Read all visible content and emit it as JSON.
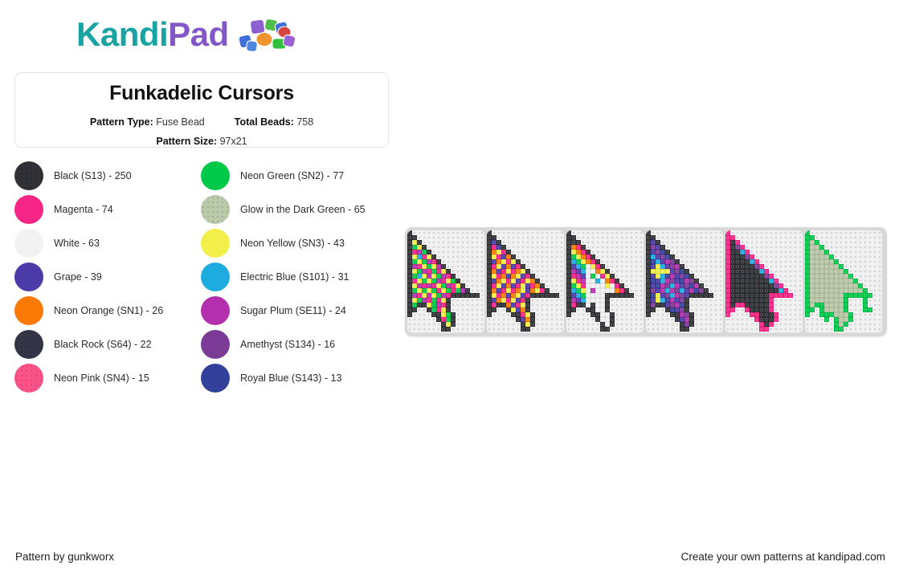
{
  "brand": {
    "name_part1": "Kandi",
    "name_part2": "Pad",
    "beads_icon": "kandi-beads-icon",
    "color_teal": "#1aa3a3",
    "color_purple": "#8457c9"
  },
  "title_card": {
    "title": "Funkadelic Cursors",
    "pattern_type_label": "Pattern Type:",
    "pattern_type_value": "Fuse Bead",
    "total_beads_label": "Total Beads:",
    "total_beads_value": "758",
    "pattern_size_label": "Pattern Size:",
    "pattern_size_value": "97x21"
  },
  "legend": {
    "items": [
      {
        "name": "Black (S13)",
        "count": "250",
        "label": "Black (S13) - 250",
        "color": "#2f3136",
        "dotted": true,
        "col": 0
      },
      {
        "name": "Neon Green (SN2)",
        "count": "77",
        "label": "Neon Green (SN2) - 77",
        "color": "#00c94a",
        "dotted": false,
        "col": 1
      },
      {
        "name": "Magenta",
        "count": "74",
        "label": "Magenta - 74",
        "color": "#f72585",
        "dotted": false,
        "col": 0
      },
      {
        "name": "Glow in the Dark Green",
        "count": "65",
        "label": "Glow in the Dark Green - 65",
        "color": "#b9c9a9",
        "dotted": true,
        "col": 1
      },
      {
        "name": "White",
        "count": "63",
        "label": "White - 63",
        "color": "#f2f2f2",
        "dotted": false,
        "col": 0
      },
      {
        "name": "Neon Yellow (SN3)",
        "count": "43",
        "label": "Neon Yellow (SN3) - 43",
        "color": "#f2ef4a",
        "dotted": false,
        "col": 1
      },
      {
        "name": "Grape",
        "count": "39",
        "label": "Grape - 39",
        "color": "#4b3ba8",
        "dotted": false,
        "col": 0
      },
      {
        "name": "Electric Blue (S101)",
        "count": "31",
        "label": "Electric Blue (S101) - 31",
        "color": "#1eace0",
        "dotted": false,
        "col": 1
      },
      {
        "name": "Neon Orange (SN1)",
        "count": "26",
        "label": "Neon Orange (SN1) - 26",
        "color": "#fb7a05",
        "dotted": false,
        "col": 0
      },
      {
        "name": "Sugar Plum (SE11)",
        "count": "24",
        "label": "Sugar Plum (SE11) - 24",
        "color": "#b32fad",
        "dotted": false,
        "col": 1
      },
      {
        "name": "Black Rock (S64)",
        "count": "22",
        "label": "Black Rock (S64) - 22",
        "color": "#343447",
        "dotted": true,
        "col": 0
      },
      {
        "name": "Amethyst (S134)",
        "count": "16",
        "label": "Amethyst (S134) - 16",
        "color": "#7b3a96",
        "dotted": false,
        "col": 1
      },
      {
        "name": "Neon Pink (SN4)",
        "count": "15",
        "label": "Neon Pink (SN4) - 15",
        "color": "#fb5388",
        "dotted": true,
        "col": 0
      },
      {
        "name": "Royal Blue (S143)",
        "count": "13",
        "label": "Royal Blue (S143) - 13",
        "color": "#33409a",
        "dotted": false,
        "col": 1
      }
    ]
  },
  "pattern": {
    "cell_size": 6,
    "rows": 21,
    "board_background": "#d8d8d8",
    "peg_background": "#f1f1f1",
    "peg_color": "#d2d2d2",
    "palette": {
      "K": "#2f3136",
      "R": "#343447",
      "M": "#f72585",
      "P": "#fb5388",
      "W": "#f2f2f2",
      "G": "#4b3ba8",
      "O": "#fb7a05",
      "N": "#00c94a",
      "D": "#b9c9a9",
      "Y": "#f2ef4a",
      "B": "#1eace0",
      "S": "#b32fad",
      "A": "#7b3a96",
      "U": "#33409a"
    },
    "panels": [
      {
        "name": "rainbow-checker-cursor",
        "cols": 16,
        "grid": [
          "K...............",
          "KK..............",
          "KYK.............",
          "KNYK............",
          "KMSNK...........",
          "KYBMYK..........",
          "KNYNSMK.........",
          "KSMYNYSK........",
          "KYNSMNMYK.......",
          "KNBYSYNSMK......",
          "KMYNYNSMYNK.....",
          "KYSMSMYNSMYK....",
          "KNYNYNMYNMNSK...",
          "KSMYSYNSMKKKKKK.",
          "KYNSMNMYK.......",
          "KNKKYNSMK.......",
          "KK..KNMYK.......",
          "K....KKYNK......",
          "......KMNK......",
          ".......KYK......",
          ".......KK......."
        ]
      },
      {
        "name": "orange-purple-cursor",
        "cols": 16,
        "grid": [
          "K...............",
          "KK..............",
          "KGK.............",
          "KMGK............",
          "KOYMK...........",
          "KYMGOK..........",
          "KGOYMYK.........",
          "KMYGOGMK........",
          "KOGMYMOYK.......",
          "KYMOGOYGMK......",
          "KGOYMYGMYOK.....",
          "KMYGOGMYGMOK....",
          "KOGMYMOYGOYMK...",
          "KYMOGOYGMKKKKKK.",
          "KGOYMYGMK.......",
          "KMKKOGMYK.......",
          "KK..KYGOK.......",
          "K....KKMYK......",
          "......KGOK......",
          ".......KYK......",
          ".......KK......."
        ]
      },
      {
        "name": "white-rainbow-outline-cursor",
        "cols": 16,
        "grid": [
          "K...............",
          "KK..............",
          "KRK.............",
          "KOMK............",
          "KYOMK...........",
          "KNYOMK..........",
          "KBNYOMK.........",
          "KGBNWYMK........",
          "KSGBWWOYK.......",
          "KMSGWNWMYK......",
          "KYMSWWBWOMK.....",
          "KNYMWWWWYWMK....",
          "KBNYWSWWWWOMK...",
          "KGBNWWWWKKKKKK..",
          "KSGBWWWWK.......",
          "KMKKWKWWK.......",
          "KK..KKWWK.......",
          "K....KKWWK......",
          "......KWWK......",
          ".......KWK......",
          ".......KK......."
        ]
      },
      {
        "name": "galaxy-star-cursor",
        "cols": 16,
        "grid": [
          "K...............",
          "KK..............",
          "KGK.............",
          "KAGK............",
          "KGAUK...........",
          "KBGAUK..........",
          "KUBGSAK.........",
          "KGYBGASK........",
          "KYYYYGAUK.......",
          "KGYBUSGAUK......",
          "KUGBSAGUSAK.....",
          "KGUSABSGAUSK....",
          "KAGSBSABGSUAK...",
          "KUYGABSAGKKKKK..",
          "KGYBUSGAK.......",
          "KAKKGASUK.......",
          "KK..KUGAK.......",
          "K....KKSAK......",
          "......KGSK......",
          ".......KAK......",
          ".......KK......."
        ]
      },
      {
        "name": "black-magenta-cursor",
        "cols": 16,
        "grid": [
          "M...............",
          "MM..............",
          "MKM.............",
          "MKAM............",
          "MKKBM...........",
          "MKKKAM..........",
          "MKKKKBM.........",
          "MKKKKKAM........",
          "MKKKKKKBM.......",
          "MKKKKKKKAM......",
          "MKKKKKKKKBM.....",
          "MKKKKKKKKKAM....",
          "MKKKKKKKKKKBM...",
          "MKKKKKKKKMMMMM..",
          "MKKKKKKKKM......",
          "MKMMKKKKKM......",
          "MM..MKKKKM......",
          "M....MMKKKM.....",
          "......MKKKM.....",
          ".......MKM......",
          ".......MM......."
        ]
      },
      {
        "name": "glow-green-drip-cursor",
        "cols": 16,
        "grid": [
          "N...............",
          "NN..............",
          "NDN.............",
          "NDDN............",
          "NDDDN...........",
          "NDDDDN..........",
          "NDDDDDN.........",
          "NDDDDDDN........",
          "NDDDDDDDN.......",
          "NDDDDDDDDN......",
          "NDDDDDDDDDN.....",
          "NDDDDDDDDDDN....",
          "NDDDDDDDDDDDN...",
          "NDDDDDDDNNNNNN..",
          "NDDDDDDDN...N...",
          "NDNNDDDDN...N...",
          "NN.NDDDDN...NN..",
          "N..NNNDDDN......",
          "....N.NDDN......",
          "......NDN.......",
          "......NN........"
        ]
      }
    ]
  },
  "footer": {
    "left": "Pattern by gunkworx",
    "right": "Create your own patterns at kandipad.com"
  }
}
